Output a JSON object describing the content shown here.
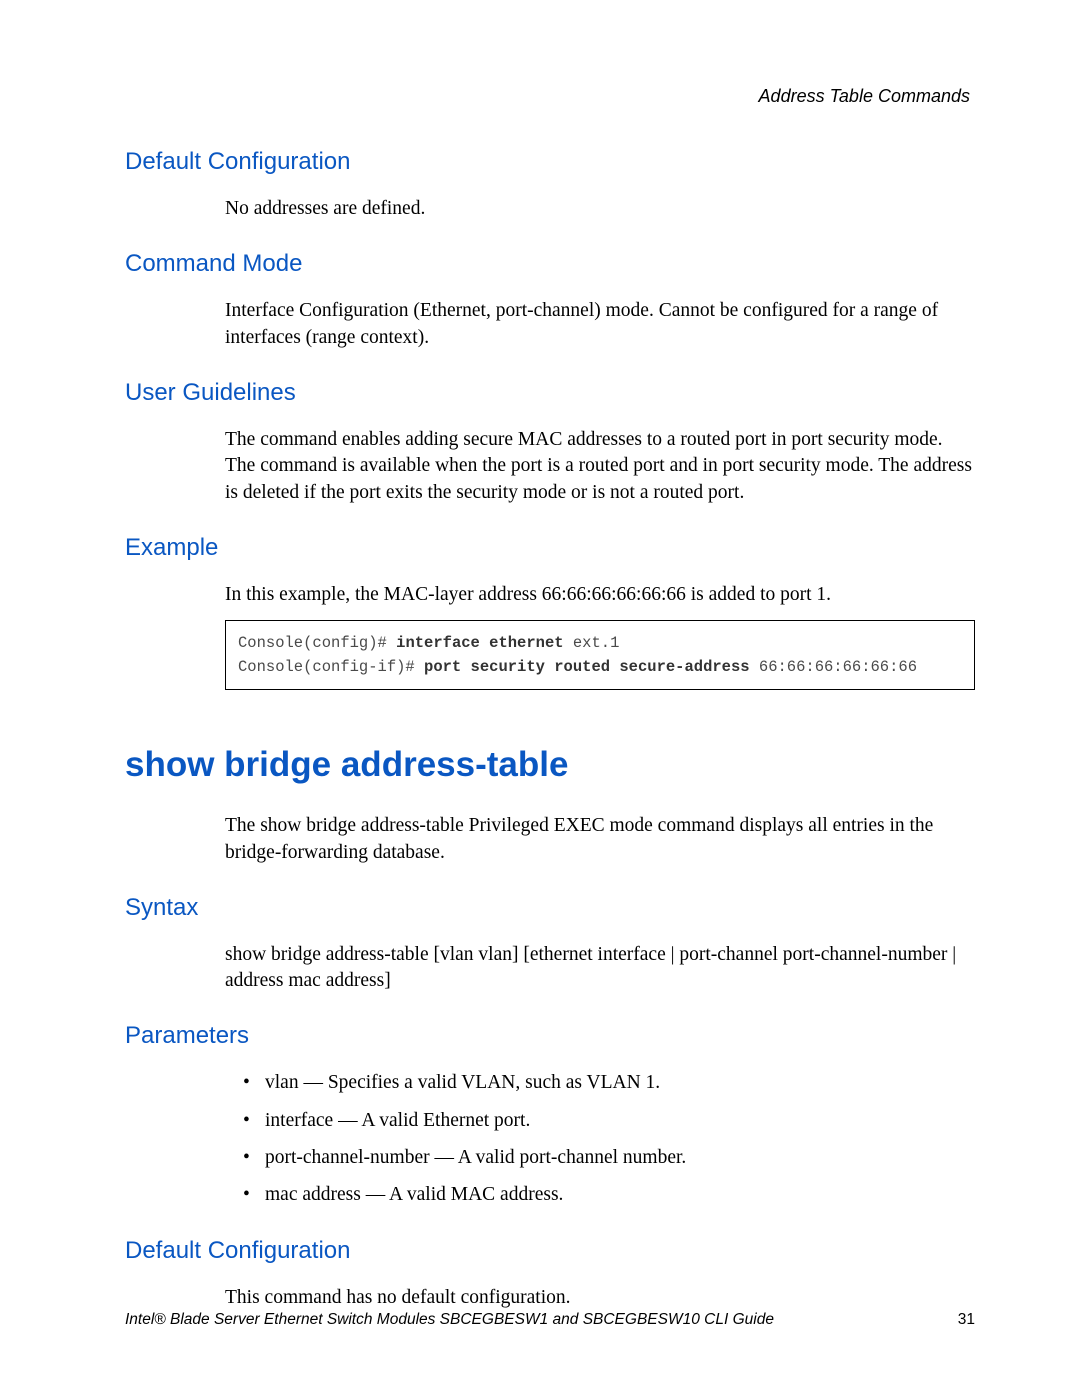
{
  "header": {
    "chapter": "Address Table Commands"
  },
  "sections": {
    "defaultConfig1": {
      "heading": "Default Configuration",
      "body": "No addresses are defined."
    },
    "commandMode": {
      "heading": "Command Mode",
      "body": "Interface Configuration (Ethernet, port-channel) mode. Cannot be configured for a range of interfaces (range context)."
    },
    "userGuidelines": {
      "heading": "User Guidelines",
      "body": "The command enables adding secure MAC addresses to a routed port in port security mode. The command is available when the port is a routed port and in port security mode. The address is deleted if the port exits the security mode or is not a routed port."
    },
    "example": {
      "heading": "Example",
      "body": "In this example, the MAC-layer address 66:66:66:66:66:66 is added to port 1.",
      "code": {
        "line1_prompt": "Console(config)# ",
        "line1_cmd": "interface ethernet ",
        "line1_arg": "ext.1",
        "line2_prompt": "Console(config-if)# ",
        "line2_cmd": "port security routed secure-address ",
        "line2_arg": "66:66:66:66:66:66"
      }
    },
    "mainCommand": {
      "heading": "show bridge address-table",
      "body": "The show bridge address-table Privileged EXEC mode command displays all entries in the bridge-forwarding database."
    },
    "syntax": {
      "heading": "Syntax",
      "body": "show bridge address-table [vlan vlan] [ethernet interface | port-channel port-channel-number | address mac address]"
    },
    "parameters": {
      "heading": "Parameters",
      "items": [
        "vlan — Specifies a valid VLAN, such as VLAN 1.",
        "interface — A valid Ethernet port.",
        "port-channel-number — A valid port-channel number.",
        "mac address — A valid MAC address."
      ]
    },
    "defaultConfig2": {
      "heading": "Default Configuration",
      "body": "This command has no default configuration."
    }
  },
  "footer": {
    "text": "Intel® Blade Server Ethernet Switch Modules SBCEGBESW1 and SBCEGBESW10 CLI Guide",
    "page": "31"
  }
}
